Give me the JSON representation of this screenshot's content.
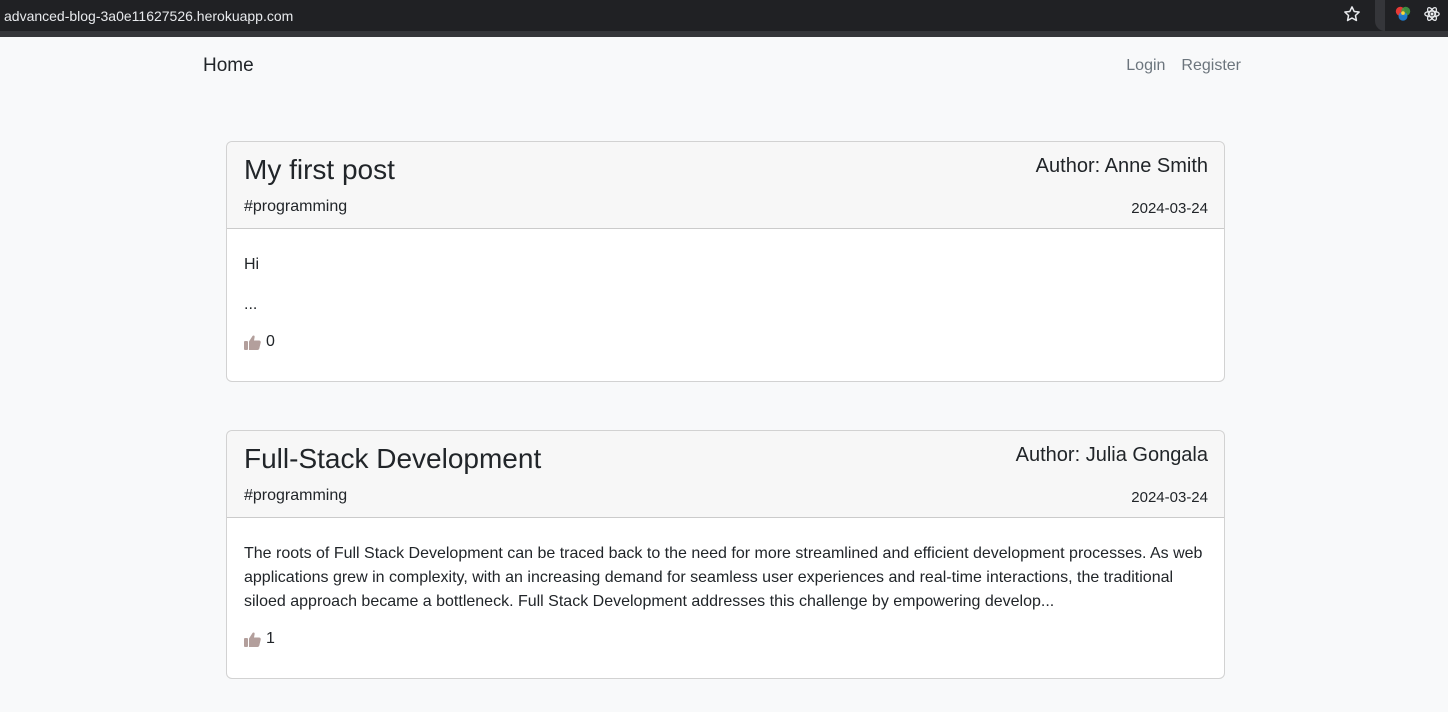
{
  "browser": {
    "url": "advanced-blog-3a0e11627526.herokuapp.com"
  },
  "navbar": {
    "brand": "Home",
    "links": [
      {
        "label": "Login"
      },
      {
        "label": "Register"
      }
    ]
  },
  "posts": [
    {
      "title": "My first post",
      "author": "Author: Anne Smith",
      "tag": "#programming",
      "date": "2024-03-24",
      "body": "Hi",
      "excerpt_suffix": "...",
      "likes": "0"
    },
    {
      "title": "Full-Stack Development",
      "author": "Author: Julia Gongala",
      "tag": "#programming",
      "date": "2024-03-24",
      "body": "The roots of Full Stack Development can be traced back to the need for more streamlined and efficient development processes. As web applications grew in complexity, with an increasing demand for seamless user experiences and real-time interactions, the traditional siloed approach became a bottleneck. Full Stack Development addresses this challenge by empowering develop...",
      "likes": "1"
    }
  ],
  "colors": {
    "page_bg": "#f8f9fa",
    "card_header_bg": "#f7f7f7",
    "like_icon": "#b39f9c",
    "muted_link": "#6c757d"
  },
  "icons": [
    "star-icon",
    "color-extension-icon",
    "react-devtools-icon",
    "thumbs-up-icon"
  ]
}
